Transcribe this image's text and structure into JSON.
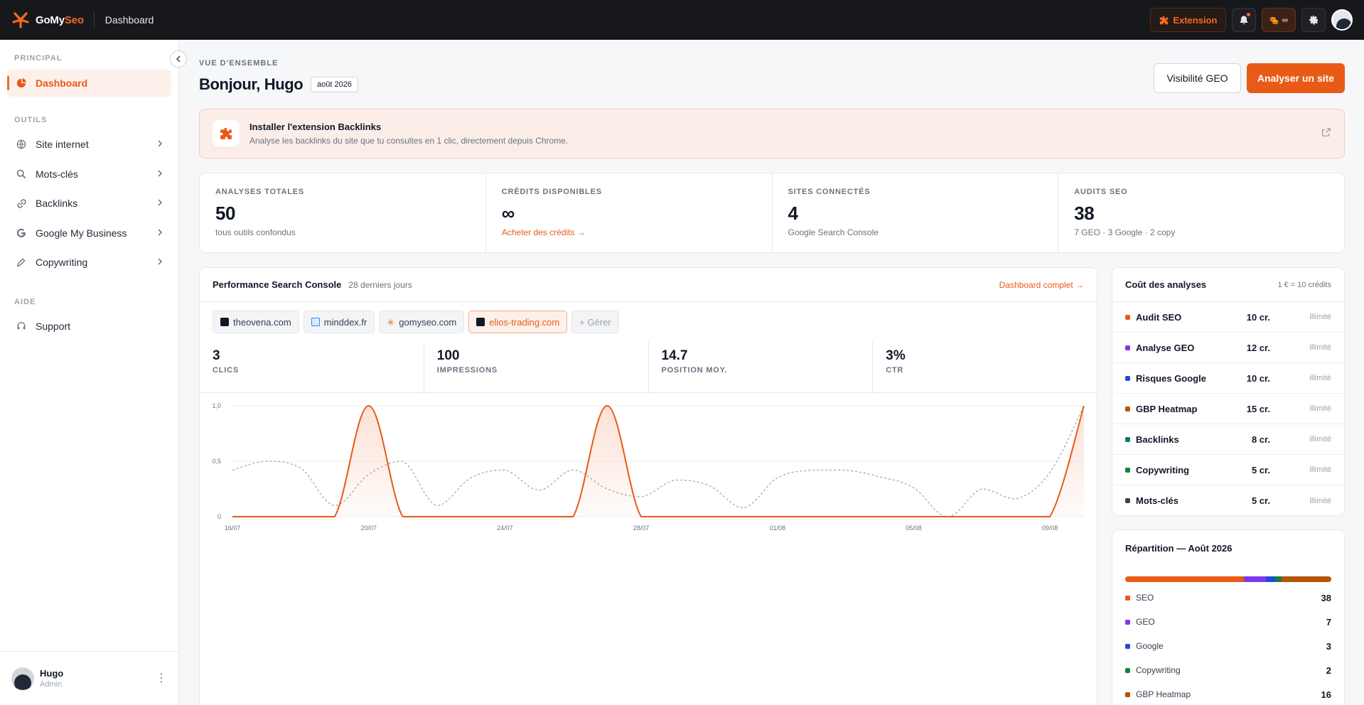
{
  "topbar": {
    "brand_part1": "GoMy",
    "brand_part2": "Seo",
    "page_title": "Dashboard",
    "extension_label": "Extension",
    "credits_label": "∞",
    "icons": [
      "logo-icon",
      "puzzle-icon",
      "bell-icon",
      "coins-icon",
      "gear-icon",
      "avatar"
    ]
  },
  "sidebar": {
    "section_principal": "PRINCIPAL",
    "section_outils": "OUTILS",
    "section_aide": "AIDE",
    "items": [
      {
        "label": "Dashboard",
        "icon": "dashboard-icon",
        "active": true
      },
      {
        "label": "Site internet",
        "icon": "globe-icon"
      },
      {
        "label": "Mots-clés",
        "icon": "search-icon"
      },
      {
        "label": "Backlinks",
        "icon": "link-icon"
      },
      {
        "label": "Google My Business",
        "icon": "google-icon"
      },
      {
        "label": "Copywriting",
        "icon": "pen-icon"
      },
      {
        "label": "Support",
        "icon": "headset-icon"
      }
    ],
    "user": {
      "name": "Hugo",
      "role": "Admin",
      "avatar_alt": "Avatar"
    }
  },
  "header": {
    "overline": "VUE D'ENSEMBLE",
    "greeting": "Bonjour, Hugo",
    "date_badge": "août 2026",
    "btn_geo": "Visibilité GEO",
    "btn_analyse": "Analyser un site"
  },
  "banner": {
    "title": "Installer l'extension Backlinks",
    "subtitle": "Analyse les backlinks du site que tu consultes en 1 clic, directement depuis Chrome."
  },
  "stats": [
    {
      "label": "ANALYSES TOTALES",
      "value": "50",
      "sub": "tous outils confondus"
    },
    {
      "label": "CRÉDITS DISPONIBLES",
      "value": "∞",
      "sub": "Acheter des crédits →"
    },
    {
      "label": "SITES CONNECTÉS",
      "value": "4",
      "sub": "Google Search Console"
    },
    {
      "label": "AUDITS SEO",
      "value": "38",
      "sub": "7 GEO · 3 Google · 2 copy"
    }
  ],
  "performance": {
    "title": "Performance Search Console",
    "period": "28 derniers jours",
    "link": "Dashboard complet →",
    "sites": [
      "theovena.com",
      "minddex.fr",
      "gomyseo.com",
      "elios-trading.com"
    ],
    "active_site": "elios-trading.com",
    "manage_label": "+ Gérer",
    "metrics": [
      {
        "value": "3",
        "label": "CLICS"
      },
      {
        "value": "100",
        "label": "IMPRESSIONS"
      },
      {
        "value": "14.7",
        "label": "POSITION MOY."
      },
      {
        "value": "3%",
        "label": "CTR"
      }
    ]
  },
  "chart_data": {
    "type": "line",
    "x": [
      "16/07",
      "17/07",
      "18/07",
      "19/07",
      "20/07",
      "21/07",
      "22/07",
      "23/07",
      "24/07",
      "25/07",
      "26/07",
      "27/07",
      "28/07",
      "29/07",
      "30/07",
      "31/07",
      "01/08",
      "02/08",
      "03/08",
      "04/08",
      "05/08",
      "06/08",
      "07/08",
      "08/08",
      "09/08",
      "10/08"
    ],
    "xticks": [
      "16/07",
      "20/07",
      "24/07",
      "28/07",
      "01/08",
      "05/08",
      "09/08"
    ],
    "yticks": [
      "0",
      "0,5",
      "1,0"
    ],
    "ylim": [
      0,
      1
    ],
    "series": [
      {
        "values": [
          0,
          0,
          0,
          0,
          1,
          0,
          0,
          0,
          0,
          0,
          0,
          1,
          0,
          0,
          0,
          0,
          0,
          0,
          0,
          0,
          0,
          0,
          0,
          0,
          0,
          1
        ],
        "color": "#e85a16",
        "style": "solid-area"
      },
      {
        "values": [
          0.42,
          0.5,
          0.44,
          0.1,
          0.38,
          0.5,
          0.1,
          0.35,
          0.42,
          0.24,
          0.42,
          0.25,
          0.18,
          0.33,
          0.28,
          0.08,
          0.35,
          0.42,
          0.42,
          0.36,
          0.26,
          0.0,
          0.25,
          0.16,
          0.4,
          1.0
        ],
        "color": "#9ca3af",
        "style": "dashed"
      }
    ]
  },
  "costs": {
    "title": "Coût des analyses",
    "note": "1 € = 10 crédits",
    "rows": [
      {
        "name": "Audit SEO",
        "credits": "10 cr.",
        "limit": "illimité",
        "color": "#e85a16"
      },
      {
        "name": "Analyse GEO",
        "credits": "12 cr.",
        "limit": "illimité",
        "color": "#7c3aed"
      },
      {
        "name": "Risques Google",
        "credits": "10 cr.",
        "limit": "illimité",
        "color": "#1d4ed8"
      },
      {
        "name": "GBP Heatmap",
        "credits": "15 cr.",
        "limit": "illimité",
        "color": "#b45309"
      },
      {
        "name": "Backlinks",
        "credits": "8 cr.",
        "limit": "illimité",
        "color": "#0f766e"
      },
      {
        "name": "Copywriting",
        "credits": "5 cr.",
        "limit": "illimité",
        "color": "#15803d"
      },
      {
        "name": "Mots-clés",
        "credits": "5 cr.",
        "limit": "illimité",
        "color": "#374151"
      }
    ]
  },
  "repartition": {
    "title": "Répartition — Août 2026",
    "rows": [
      {
        "name": "SEO",
        "value": 38,
        "color": "#e85a16"
      },
      {
        "name": "GEO",
        "value": 7,
        "color": "#7c3aed"
      },
      {
        "name": "Google",
        "value": 3,
        "color": "#1d4ed8"
      },
      {
        "name": "Copywriting",
        "value": 2,
        "color": "#15803d"
      },
      {
        "name": "GBP Heatmap",
        "value": 16,
        "color": "#b45309"
      }
    ]
  }
}
